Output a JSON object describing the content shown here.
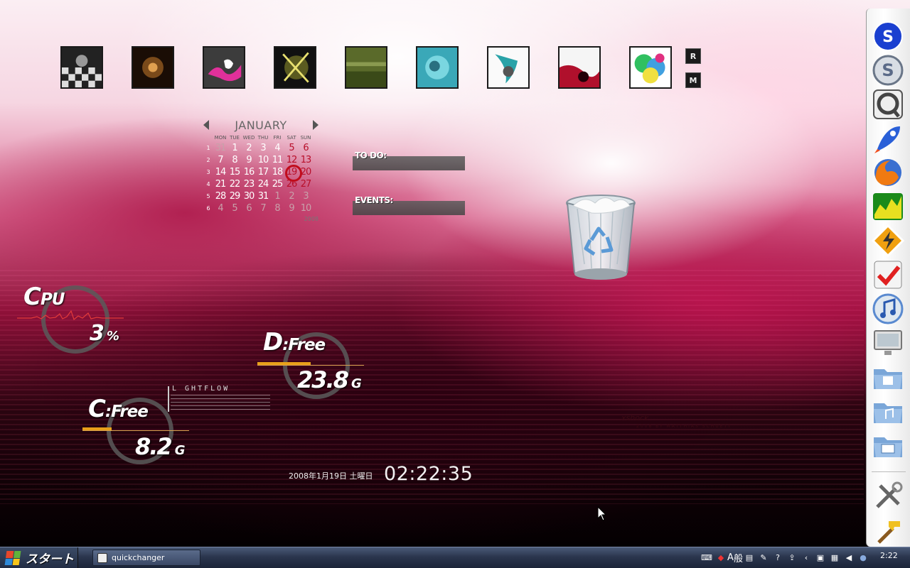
{
  "colors": {
    "accent_red": "#c10c1c",
    "gauge_orange": "#e8a01a",
    "taskbar": "#2b364e"
  },
  "thumbnails": [
    {
      "name": "wallpaper-thumb-checkerboard",
      "icon": "checkerboard-image"
    },
    {
      "name": "wallpaper-thumb-dark-room",
      "icon": "dark-room-image"
    },
    {
      "name": "wallpaper-thumb-pink-splash",
      "icon": "pink-splash-image"
    },
    {
      "name": "wallpaper-thumb-yellow-burst",
      "icon": "yellow-burst-image"
    },
    {
      "name": "wallpaper-thumb-green-field",
      "icon": "green-field-image"
    },
    {
      "name": "wallpaper-thumb-cyan-water",
      "icon": "cyan-water-image"
    },
    {
      "name": "wallpaper-thumb-white-teal",
      "icon": "white-teal-image"
    },
    {
      "name": "wallpaper-thumb-red-dark",
      "icon": "red-dark-image"
    },
    {
      "name": "wallpaper-thumb-rainbow",
      "icon": "rainbow-image"
    }
  ],
  "thumb_buttons": {
    "random": "R",
    "menu": "M"
  },
  "calendar": {
    "month": "JANUARY",
    "year": "2008",
    "weekdays": [
      "MON",
      "TUE",
      "WED",
      "THU",
      "FRI",
      "SAT",
      "SUN"
    ],
    "weeks": [
      {
        "num": "1",
        "days": [
          "31",
          "1",
          "2",
          "3",
          "4",
          "5",
          "6"
        ]
      },
      {
        "num": "2",
        "days": [
          "7",
          "8",
          "9",
          "10",
          "11",
          "12",
          "13"
        ]
      },
      {
        "num": "3",
        "days": [
          "14",
          "15",
          "16",
          "17",
          "18",
          "19",
          "20"
        ]
      },
      {
        "num": "4",
        "days": [
          "21",
          "22",
          "23",
          "24",
          "25",
          "26",
          "27"
        ]
      },
      {
        "num": "5",
        "days": [
          "28",
          "29",
          "30",
          "31",
          "1",
          "2",
          "3"
        ]
      },
      {
        "num": "6",
        "days": [
          "4",
          "5",
          "6",
          "7",
          "8",
          "9",
          "10"
        ]
      }
    ],
    "today": "19"
  },
  "notes": {
    "todo_label": "TO DO:",
    "events_label": "EVENTS:"
  },
  "cpu": {
    "title_letter": "C",
    "title_rest": "PU",
    "value": "3",
    "unit": "%",
    "percent": 3
  },
  "drive_d": {
    "title_letter": "D",
    "title_rest": ":Free",
    "value": "23.8",
    "unit": "G",
    "fill_fraction": 0.5
  },
  "drive_c": {
    "title_letter": "C",
    "title_rest": ":Free",
    "value": "8.2",
    "unit": "G",
    "fill_fraction": 0.27
  },
  "lightflow": {
    "label": "L   GHTFLOW"
  },
  "clock": {
    "date": "2008年1月19日 土曜日",
    "time": "02:22:35"
  },
  "credits": {
    "line1": "xshock",
    "line2": "2008 BY MATTHIAS SCHUETT"
  },
  "desktop_icons": {
    "recycle_bin": "recycle-bin-icon"
  },
  "dock": [
    {
      "name": "dock-skype-icon",
      "icon": "skype-icon"
    },
    {
      "name": "dock-s-app-icon",
      "icon": "s-app-icon"
    },
    {
      "name": "dock-quicktime-icon",
      "icon": "quicktime-icon"
    },
    {
      "name": "dock-rocket-icon",
      "icon": "rocket-icon"
    },
    {
      "name": "dock-firefox-icon",
      "icon": "firefox-icon"
    },
    {
      "name": "dock-chart-app-icon",
      "icon": "chart-app-icon"
    },
    {
      "name": "dock-bolt-app-icon",
      "icon": "bolt-app-icon"
    },
    {
      "name": "dock-checkmark-app-icon",
      "icon": "checkmark-app-icon"
    },
    {
      "name": "dock-itunes-icon",
      "icon": "itunes-icon"
    },
    {
      "name": "dock-monitor-icon",
      "icon": "monitor-icon"
    },
    {
      "name": "dock-folder-documents-icon",
      "icon": "folder-documents-icon"
    },
    {
      "name": "dock-folder-music-icon",
      "icon": "folder-music-icon"
    },
    {
      "name": "dock-folder-pictures-icon",
      "icon": "folder-pictures-icon"
    },
    {
      "name": "dock-tools-icon",
      "icon": "tools-icon"
    },
    {
      "name": "dock-hammer-icon",
      "icon": "hammer-icon"
    }
  ],
  "taskbar": {
    "start_label": "スタート",
    "task_label": "quickchanger",
    "ime_a": "A",
    "ime_mode": "般",
    "clock_text": "2:22"
  }
}
